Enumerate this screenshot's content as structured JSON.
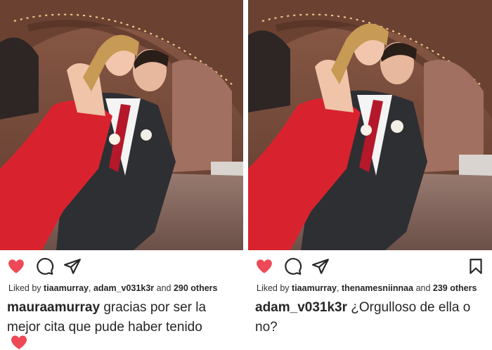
{
  "posts": [
    {
      "likes": {
        "prefix": "Liked by",
        "user1": "tiaamurray",
        "sep": ",",
        "user2": "adam_v031k3r",
        "middle": "and",
        "count": "290 others"
      },
      "caption": {
        "username": "mauraamurray",
        "text": "gracias por ser la mejor cita que pude haber tenido"
      },
      "liked": true,
      "show_bookmark": false
    },
    {
      "likes": {
        "prefix": "Liked by",
        "user1": "tiaamurray",
        "sep": ",",
        "user2": "thenamesniinnaa",
        "middle": "and",
        "count": "239 others"
      },
      "caption": {
        "username": "adam_v031k3r",
        "text": "¿Orgulloso de ella o no?"
      },
      "liked": true,
      "show_bookmark": true
    }
  ],
  "icons": {
    "like": "heart-icon",
    "comment": "comment-icon",
    "share": "send-icon",
    "save": "bookmark-icon"
  },
  "colors": {
    "like_red": "#ed4956",
    "text": "#262626",
    "dress_red": "#d8232e"
  }
}
